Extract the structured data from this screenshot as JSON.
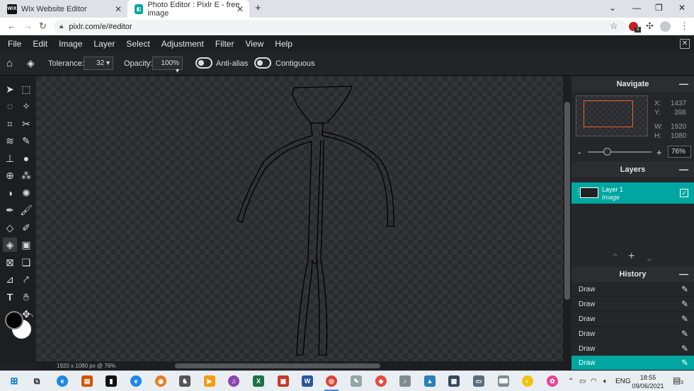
{
  "browser": {
    "tabs": [
      {
        "title": "Wix Website Editor",
        "favicon": "wix-icon",
        "favicon_text": "WiX",
        "active": false
      },
      {
        "title": "Photo Editor : Pixlr E - free image",
        "favicon": "pixlr-icon",
        "active": true
      }
    ],
    "new_tab_glyph": "+",
    "url": "pixlr.com/e/#editor",
    "extension_badge": "3"
  },
  "menu": [
    "File",
    "Edit",
    "Image",
    "Layer",
    "Select",
    "Adjustment",
    "Filter",
    "View",
    "Help"
  ],
  "options": {
    "tolerance_label": "Tolerance:",
    "tolerance_value": "32",
    "opacity_label": "Opacity:",
    "opacity_value": "100%",
    "antialias_label": "Anti-alias",
    "contiguous_label": "Contiguous"
  },
  "tools": [
    "arrange-tool",
    "marquee-select-tool",
    "lasso-select-tool",
    "magic-wand-tool",
    "crop-tool",
    "cutout-tool",
    "liquify-tool",
    "heal-tool",
    "clone-stamp-tool",
    "blur-tool",
    "sponge-tool",
    "dodge-burn-tool",
    "color-replace-tool",
    "sharpen-tool",
    "pen-tool",
    "brush-tool",
    "eraser-tool",
    "replace-color-brush-tool",
    "fill-tool",
    "gradient-tool",
    "drawing-tool",
    "shape-tool",
    "color-picker-tool",
    "eyedropper-tool",
    "text-tool",
    "hand-tool",
    "zoom-tool",
    "pan-tool"
  ],
  "colors": {
    "foreground": "#000000",
    "background": "#ffffff",
    "accent": "#00a7a0"
  },
  "status": "1920 x 1080 px @ 76%",
  "navigate": {
    "title": "Navigate",
    "x_label": "X:",
    "x_value": "1437",
    "y_label": "Y:",
    "y_value": "398",
    "w_label": "W:",
    "w_value": "1920",
    "h_label": "H:",
    "h_value": "1080",
    "zoom_minus": "-",
    "zoom_plus": "+",
    "zoom": "76%"
  },
  "layers": {
    "title": "Layers",
    "items": [
      {
        "name": "Layer 1",
        "type": "Image",
        "visible": true
      }
    ]
  },
  "history": {
    "title": "History",
    "items": [
      "Draw",
      "Draw",
      "Draw",
      "Draw",
      "Draw",
      "Draw"
    ]
  },
  "taskbar": {
    "language": "ENG",
    "time": "18:55",
    "date": "09/06/2021",
    "notifications": "3"
  }
}
